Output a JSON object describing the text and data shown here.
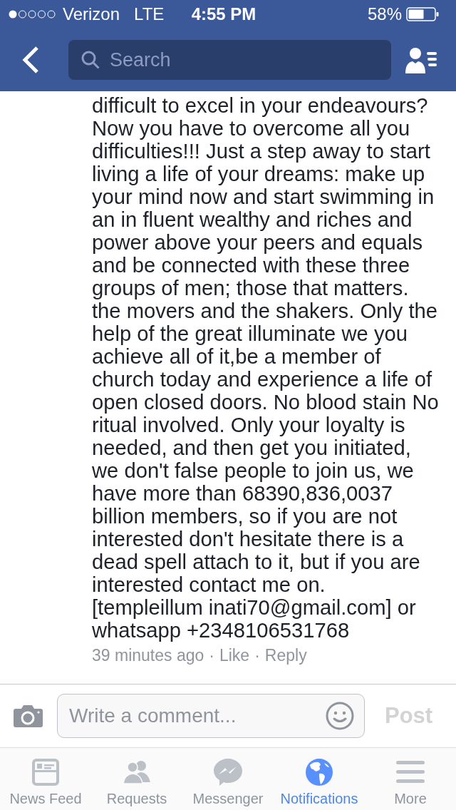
{
  "status_bar": {
    "carrier": "Verizon",
    "network": "LTE",
    "time": "4:55 PM",
    "battery": "58%"
  },
  "nav_bar": {
    "search": {
      "placeholder": "Search"
    }
  },
  "comment": {
    "text": "difficult to excel in your endeavours? Now you have to overcome all you difficulties!!! Just a step away to start living a life of your dreams: make up your mind now and start swimming in an in fluent wealthy and riches and power above your peers and equals and be connected with these three groups of men; those that matters. the movers and the shakers. Only the help of the great illuminate we you achieve all of it,be a member of church today and experience a life of open closed doors. No blood stain No ritual involved. Only your loyalty is needed, and then get you initiated, we don't false people to join us, we have more than 68390,836,0037 billion members, so if you are not interested don't hesitate there is a dead spell attach to it, but if you are interested contact me on. [templeillum inati70@gmail.com] or whatsapp +2348106531768",
    "meta": [
      {
        "kind": "time",
        "text": "39 minutes ago"
      },
      {
        "kind": "separator",
        "text": "·"
      },
      {
        "kind": "link",
        "text": "Like"
      },
      {
        "kind": "separator",
        "text": "·"
      },
      {
        "kind": "link",
        "text": "Reply"
      }
    ]
  },
  "composer": {
    "placeholder": "Write a comment...",
    "post_button": "Post",
    "post_disabled": true
  },
  "tabs": [
    {
      "kind": "news-feed",
      "label": "News Feed",
      "selected": false
    },
    {
      "kind": "requests",
      "label": "Requests",
      "selected": false
    },
    {
      "kind": "messenger",
      "label": "Messenger",
      "selected": false
    },
    {
      "kind": "notifications",
      "label": "Notifications",
      "selected": true
    },
    {
      "kind": "more",
      "label": "More",
      "selected": false
    }
  ]
}
